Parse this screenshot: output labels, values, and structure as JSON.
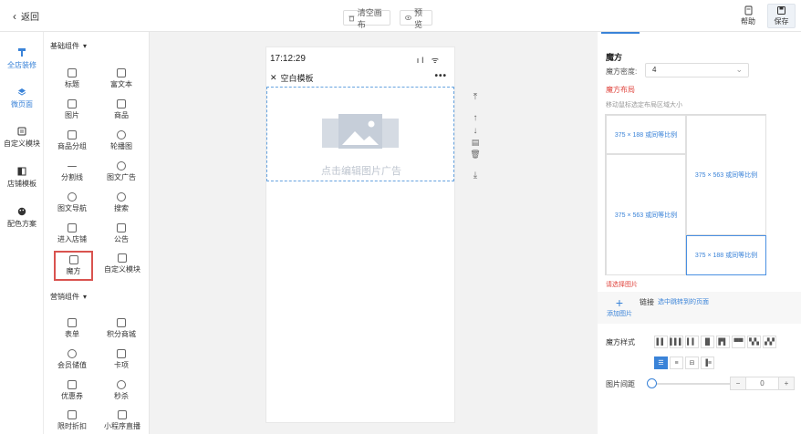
{
  "header": {
    "back_label": "返回",
    "clear_label": "清空画布",
    "preview_label": "预览",
    "help_label": "帮助",
    "save_label": "保存"
  },
  "nav": {
    "items": [
      "全店装修",
      "微页面",
      "自定义模块",
      "店铺模板",
      "配色方案"
    ],
    "active_index": 0
  },
  "components": {
    "basic_title": "基础组件",
    "basic": [
      "标题",
      "富文本",
      "图片",
      "商品",
      "商品分组",
      "轮播图",
      "分割线",
      "图文广告",
      "图文导航",
      "搜索",
      "进入店铺",
      "公告",
      "魔方",
      "自定义模块"
    ],
    "marketing_title": "营销组件",
    "marketing": [
      "表单",
      "积分商城",
      "会员储值",
      "卡项",
      "优惠券",
      "秒杀",
      "限时折扣",
      "小程序直播"
    ],
    "selected": "魔方"
  },
  "phone": {
    "time": "17:12:29",
    "title": "空白模板",
    "placeholder": "点击编辑图片广告"
  },
  "panel": {
    "title": "魔方",
    "density_label": "魔方密度:",
    "density_value": "4",
    "layout_label": "魔方布局",
    "layout_hint": "移动鼠标选定布局区域大小",
    "cells": [
      "375 × 188 或同等比例",
      "375 × 563 或同等比例",
      "375 × 563 或同等比例",
      "375 × 188 或同等比例"
    ],
    "select_image_label": "请选择图片",
    "add_image_label": "添加图片",
    "link_label": "链接",
    "link_value": "选中跳转到的页面",
    "style_label": "魔方样式",
    "spacing_label": "图片间距",
    "spacing_value": "0",
    "spacing_fraction": 0
  },
  "colors": {
    "accent": "#3a83d8",
    "danger": "#e0463f"
  }
}
